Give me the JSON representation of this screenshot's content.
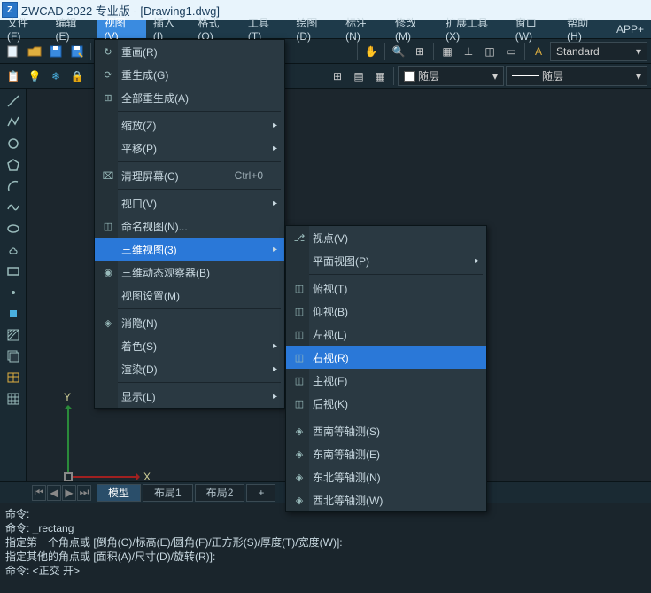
{
  "title": "ZWCAD 2022 专业版 - [Drawing1.dwg]",
  "menubar": [
    "文件(F)",
    "编辑(E)",
    "视图(V)",
    "插入(I)",
    "格式(O)",
    "工具(T)",
    "绘图(D)",
    "标注(N)",
    "修改(M)",
    "扩展工具(X)",
    "窗口(W)",
    "帮助(H)",
    "APP+"
  ],
  "menubar_active_index": 2,
  "toolbar2": {
    "layer_label": "随层",
    "style_label": "Standard",
    "bylayer_label": "随层"
  },
  "tab": {
    "active": "Drawing1"
  },
  "axis": {
    "x": "X",
    "y": "Y"
  },
  "layout_tabs": [
    "模型",
    "布局1",
    "布局2",
    "+"
  ],
  "layout_active_index": 0,
  "cmdline": [
    "命令:",
    "命令: _rectang",
    "指定第一个角点或 [倒角(C)/标高(E)/圆角(F)/正方形(S)/厚度(T)/宽度(W)]:",
    "指定其他的角点或 [面积(A)/尺寸(D)/旋转(R)]:",
    "命令: <正交 开>"
  ],
  "view_menu": [
    {
      "label": "重画(R)",
      "icon": "↻"
    },
    {
      "label": "重生成(G)",
      "icon": "⟳"
    },
    {
      "label": "全部重生成(A)",
      "icon": "⊞"
    },
    {
      "sep": true
    },
    {
      "label": "缩放(Z)",
      "sub": true
    },
    {
      "label": "平移(P)",
      "sub": true
    },
    {
      "sep": true
    },
    {
      "label": "清理屏幕(C)",
      "icon": "⌧",
      "shortcut": "Ctrl+0"
    },
    {
      "sep": true
    },
    {
      "label": "视口(V)",
      "sub": true
    },
    {
      "label": "命名视图(N)...",
      "icon": "◫"
    },
    {
      "label": "三维视图(3)",
      "sub": true,
      "hl": true
    },
    {
      "label": "三维动态观察器(B)",
      "icon": "◉"
    },
    {
      "label": "视图设置(M)"
    },
    {
      "sep": true
    },
    {
      "label": "消隐(N)",
      "icon": "◈"
    },
    {
      "label": "着色(S)",
      "sub": true
    },
    {
      "label": "渲染(D)",
      "sub": true
    },
    {
      "sep": true
    },
    {
      "label": "显示(L)",
      "sub": true
    }
  ],
  "view3d_menu": [
    {
      "label": "视点(V)",
      "icon": "⎇"
    },
    {
      "label": "平面视图(P)",
      "sub": true
    },
    {
      "sep": true
    },
    {
      "label": "俯视(T)",
      "icon": "◫"
    },
    {
      "label": "仰视(B)",
      "icon": "◫"
    },
    {
      "label": "左视(L)",
      "icon": "◫"
    },
    {
      "label": "右视(R)",
      "icon": "◫",
      "hl": true
    },
    {
      "label": "主视(F)",
      "icon": "◫"
    },
    {
      "label": "后视(K)",
      "icon": "◫"
    },
    {
      "sep": true
    },
    {
      "label": "西南等轴测(S)",
      "icon": "◈"
    },
    {
      "label": "东南等轴测(E)",
      "icon": "◈"
    },
    {
      "label": "东北等轴测(N)",
      "icon": "◈"
    },
    {
      "label": "西北等轴测(W)",
      "icon": "◈"
    }
  ]
}
